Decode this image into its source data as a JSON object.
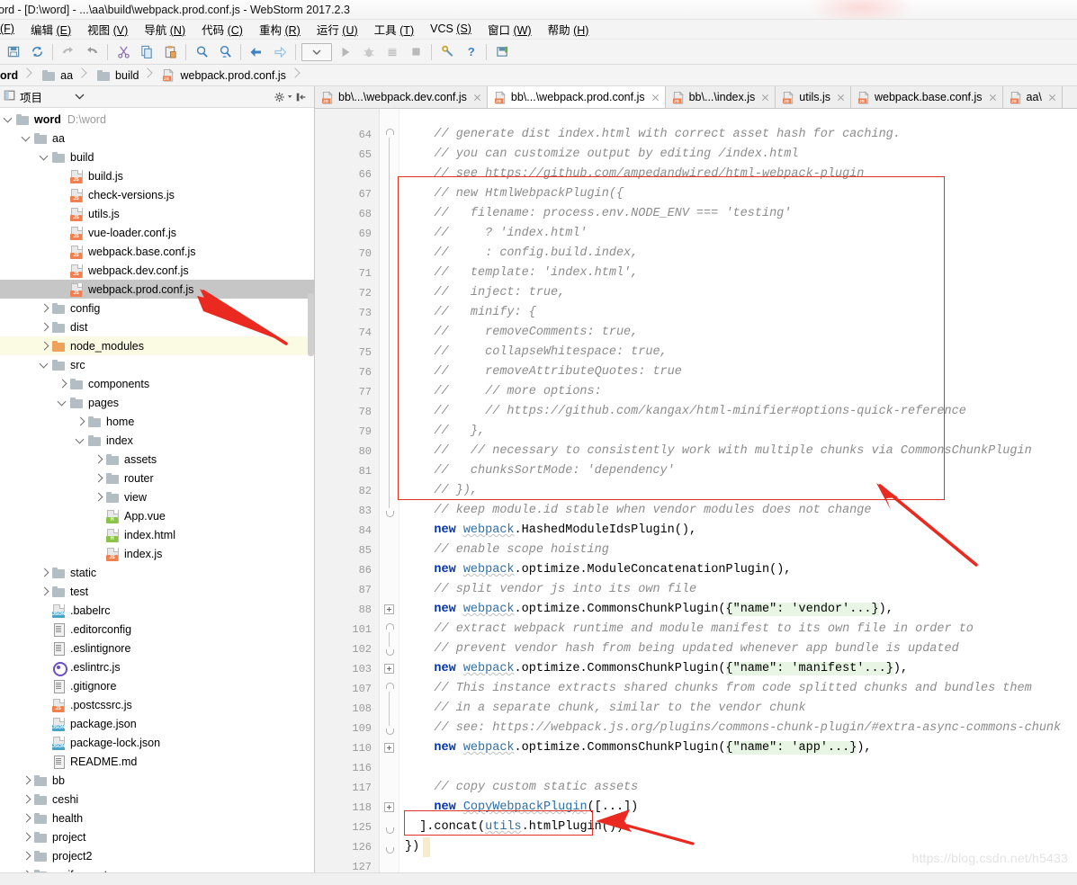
{
  "window": {
    "title": "ord - [D:\\word] - ...\\aa\\build\\webpack.prod.conf.js - WebStorm 2017.2.3"
  },
  "menubar": {
    "items": [
      {
        "label": "",
        "mnemonic": "(F)"
      },
      {
        "label": "编辑 ",
        "mnemonic": "(E)"
      },
      {
        "label": "视图 ",
        "mnemonic": "(V)"
      },
      {
        "label": "导航 ",
        "mnemonic": "(N)"
      },
      {
        "label": "代码 ",
        "mnemonic": "(C)"
      },
      {
        "label": "重构 ",
        "mnemonic": "(R)"
      },
      {
        "label": "运行 ",
        "mnemonic": "(U)"
      },
      {
        "label": "工具 ",
        "mnemonic": "(T)"
      },
      {
        "label": "VCS ",
        "mnemonic": "(S)"
      },
      {
        "label": "窗口 ",
        "mnemonic": "(W)"
      },
      {
        "label": "帮助 ",
        "mnemonic": "(H)"
      }
    ]
  },
  "toolbar": {
    "buttons": [
      "save-all-icon",
      "sync-icon",
      "sep",
      "undo-icon",
      "redo-icon",
      "sep",
      "cut-icon",
      "copy-icon",
      "paste-icon",
      "sep",
      "find-icon",
      "replace-icon",
      "sep",
      "back-icon",
      "forward-icon",
      "sep",
      "run-config-combo",
      "run-icon",
      "debug-icon",
      "coverage-icon",
      "stop-icon",
      "sep",
      "settings-wrench-icon",
      "help-icon",
      "sep",
      "save-screenshot-icon"
    ]
  },
  "breadcrumb": {
    "items": [
      {
        "label": "ord",
        "icon": "none",
        "bold": true
      },
      {
        "label": "aa",
        "icon": "folder"
      },
      {
        "label": "build",
        "icon": "folder"
      },
      {
        "label": "webpack.prod.conf.js",
        "icon": "js-file"
      }
    ]
  },
  "project_panel": {
    "header": {
      "title": "项目",
      "dropdown_icon": "chevron-down-icon",
      "settings_icon": "gear-icon",
      "hide_icon": "collapse-icon"
    },
    "tree": [
      {
        "depth": 0,
        "arrow": "down",
        "icon": "folder",
        "label": "word",
        "bold": true,
        "sub": "D:\\word"
      },
      {
        "depth": 1,
        "arrow": "down",
        "icon": "folder",
        "label": "aa"
      },
      {
        "depth": 2,
        "arrow": "down",
        "icon": "folder",
        "label": "build"
      },
      {
        "depth": 3,
        "arrow": "none",
        "icon": "js",
        "label": "build.js"
      },
      {
        "depth": 3,
        "arrow": "none",
        "icon": "js",
        "label": "check-versions.js"
      },
      {
        "depth": 3,
        "arrow": "none",
        "icon": "js",
        "label": "utils.js"
      },
      {
        "depth": 3,
        "arrow": "none",
        "icon": "js",
        "label": "vue-loader.conf.js"
      },
      {
        "depth": 3,
        "arrow": "none",
        "icon": "js",
        "label": "webpack.base.conf.js"
      },
      {
        "depth": 3,
        "arrow": "none",
        "icon": "js",
        "label": "webpack.dev.conf.js"
      },
      {
        "depth": 3,
        "arrow": "none",
        "icon": "js",
        "label": "webpack.prod.conf.js",
        "state": "selected"
      },
      {
        "depth": 2,
        "arrow": "right",
        "icon": "folder",
        "label": "config"
      },
      {
        "depth": 2,
        "arrow": "right",
        "icon": "folder",
        "label": "dist"
      },
      {
        "depth": 2,
        "arrow": "right",
        "icon": "folder-orange",
        "label": "node_modules",
        "state": "highlight"
      },
      {
        "depth": 2,
        "arrow": "down",
        "icon": "folder",
        "label": "src"
      },
      {
        "depth": 3,
        "arrow": "right",
        "icon": "folder",
        "label": "components"
      },
      {
        "depth": 3,
        "arrow": "down",
        "icon": "folder",
        "label": "pages"
      },
      {
        "depth": 4,
        "arrow": "right",
        "icon": "folder",
        "label": "home"
      },
      {
        "depth": 4,
        "arrow": "down",
        "icon": "folder",
        "label": "index"
      },
      {
        "depth": 5,
        "arrow": "right",
        "icon": "folder",
        "label": "assets"
      },
      {
        "depth": 5,
        "arrow": "right",
        "icon": "folder",
        "label": "router"
      },
      {
        "depth": 5,
        "arrow": "right",
        "icon": "folder",
        "label": "view"
      },
      {
        "depth": 5,
        "arrow": "none",
        "icon": "html",
        "label": "App.vue"
      },
      {
        "depth": 5,
        "arrow": "none",
        "icon": "html",
        "label": "index.html"
      },
      {
        "depth": 5,
        "arrow": "none",
        "icon": "js",
        "label": "index.js"
      },
      {
        "depth": 2,
        "arrow": "right",
        "icon": "folder",
        "label": "static"
      },
      {
        "depth": 2,
        "arrow": "right",
        "icon": "folder",
        "label": "test"
      },
      {
        "depth": 2,
        "arrow": "none",
        "icon": "json",
        "label": ".babelrc"
      },
      {
        "depth": 2,
        "arrow": "none",
        "icon": "txt",
        "label": ".editorconfig"
      },
      {
        "depth": 2,
        "arrow": "none",
        "icon": "txt",
        "label": ".eslintignore"
      },
      {
        "depth": 2,
        "arrow": "none",
        "icon": "circle",
        "label": ".eslintrc.js"
      },
      {
        "depth": 2,
        "arrow": "none",
        "icon": "txt",
        "label": ".gitignore"
      },
      {
        "depth": 2,
        "arrow": "none",
        "icon": "js",
        "label": ".postcssrc.js"
      },
      {
        "depth": 2,
        "arrow": "none",
        "icon": "json",
        "label": "package.json"
      },
      {
        "depth": 2,
        "arrow": "none",
        "icon": "json",
        "label": "package-lock.json"
      },
      {
        "depth": 2,
        "arrow": "none",
        "icon": "txt",
        "label": "README.md"
      },
      {
        "depth": 1,
        "arrow": "right",
        "icon": "folder",
        "label": "bb"
      },
      {
        "depth": 1,
        "arrow": "right",
        "icon": "folder",
        "label": "ceshi"
      },
      {
        "depth": 1,
        "arrow": "right",
        "icon": "folder",
        "label": "health"
      },
      {
        "depth": 1,
        "arrow": "right",
        "icon": "folder",
        "label": "project"
      },
      {
        "depth": 1,
        "arrow": "right",
        "icon": "folder",
        "label": "project2"
      },
      {
        "depth": 1,
        "arrow": "right",
        "icon": "folder",
        "label": "verify-master"
      }
    ]
  },
  "editor": {
    "tabs": [
      {
        "label": "bb\\...\\webpack.dev.conf.js",
        "icon": "js-file",
        "active": false
      },
      {
        "label": "bb\\...\\webpack.prod.conf.js",
        "icon": "js-file",
        "active": true
      },
      {
        "label": "bb\\...\\index.js",
        "icon": "js-file",
        "active": false
      },
      {
        "label": "utils.js",
        "icon": "js-file",
        "active": false
      },
      {
        "label": "webpack.base.conf.js",
        "icon": "js-file",
        "active": false
      },
      {
        "label": "aa\\",
        "icon": "js-file",
        "active": false
      }
    ],
    "lines": [
      {
        "num": "",
        "fold": "",
        "tokens": [
          {
            "t": "    //",
            "c": "cmt"
          }
        ],
        "clip": true
      },
      {
        "num": "64",
        "fold": "topcap",
        "tokens": [
          {
            "t": "    // generate dist index.html with correct asset hash for caching.",
            "c": "cmt"
          }
        ]
      },
      {
        "num": "65",
        "fold": "line",
        "tokens": [
          {
            "t": "    // you can customize output by editing /index.html",
            "c": "cmt"
          }
        ]
      },
      {
        "num": "66",
        "fold": "line",
        "tokens": [
          {
            "t": "    // see https://github.com/ampedandwired/html-webpack-plugin",
            "c": "cmt"
          }
        ]
      },
      {
        "num": "67",
        "fold": "line",
        "tokens": [
          {
            "t": "    // new HtmlWebpackPlugin({",
            "c": "cmt"
          }
        ]
      },
      {
        "num": "68",
        "fold": "line",
        "tokens": [
          {
            "t": "    //   filename: process.env.NODE_ENV === 'testing'",
            "c": "cmt"
          }
        ]
      },
      {
        "num": "69",
        "fold": "line",
        "tokens": [
          {
            "t": "    //     ? 'index.html'",
            "c": "cmt"
          }
        ]
      },
      {
        "num": "70",
        "fold": "line",
        "tokens": [
          {
            "t": "    //     : config.build.index,",
            "c": "cmt"
          }
        ]
      },
      {
        "num": "71",
        "fold": "line",
        "tokens": [
          {
            "t": "    //   template: 'index.html',",
            "c": "cmt"
          }
        ]
      },
      {
        "num": "72",
        "fold": "line",
        "tokens": [
          {
            "t": "    //   inject: true,",
            "c": "cmt"
          }
        ]
      },
      {
        "num": "73",
        "fold": "line",
        "tokens": [
          {
            "t": "    //   minify: {",
            "c": "cmt"
          }
        ]
      },
      {
        "num": "74",
        "fold": "line",
        "tokens": [
          {
            "t": "    //     removeComments: true,",
            "c": "cmt"
          }
        ]
      },
      {
        "num": "75",
        "fold": "line",
        "tokens": [
          {
            "t": "    //     collapseWhitespace: true,",
            "c": "cmt"
          }
        ]
      },
      {
        "num": "76",
        "fold": "line",
        "tokens": [
          {
            "t": "    //     removeAttributeQuotes: true",
            "c": "cmt"
          }
        ]
      },
      {
        "num": "77",
        "fold": "line",
        "tokens": [
          {
            "t": "    //     // more options:",
            "c": "cmt"
          }
        ]
      },
      {
        "num": "78",
        "fold": "line",
        "tokens": [
          {
            "t": "    //     // https://github.com/kangax/html-minifier#options-quick-reference",
            "c": "cmt"
          }
        ]
      },
      {
        "num": "79",
        "fold": "line",
        "tokens": [
          {
            "t": "    //   },",
            "c": "cmt"
          }
        ]
      },
      {
        "num": "80",
        "fold": "line",
        "tokens": [
          {
            "t": "    //   // necessary to consistently work with multiple chunks via CommonsChunkPlugin",
            "c": "cmt"
          }
        ]
      },
      {
        "num": "81",
        "fold": "line",
        "tokens": [
          {
            "t": "    //   chunksSortMode: 'dependency'",
            "c": "cmt"
          }
        ]
      },
      {
        "num": "82",
        "fold": "line",
        "tokens": [
          {
            "t": "    // }),",
            "c": "cmt"
          }
        ]
      },
      {
        "num": "83",
        "fold": "botcap",
        "tokens": [
          {
            "t": "    // keep module.id stable when vendor modules does not change",
            "c": "cmt"
          }
        ]
      },
      {
        "num": "84",
        "fold": "",
        "tokens": [
          {
            "t": "    ",
            "c": "pln"
          },
          {
            "t": "new",
            "c": "kw"
          },
          {
            "t": " ",
            "c": "pln"
          },
          {
            "t": "webpack",
            "c": "idn"
          },
          {
            "t": ".HashedModuleIdsPlugin(),",
            "c": "pln"
          }
        ]
      },
      {
        "num": "85",
        "fold": "",
        "tokens": [
          {
            "t": "    // enable scope hoisting",
            "c": "cmt"
          }
        ]
      },
      {
        "num": "86",
        "fold": "",
        "tokens": [
          {
            "t": "    ",
            "c": "pln"
          },
          {
            "t": "new",
            "c": "kw"
          },
          {
            "t": " ",
            "c": "pln"
          },
          {
            "t": "webpack",
            "c": "idn"
          },
          {
            "t": ".optimize.ModuleConcatenationPlugin(),",
            "c": "pln"
          }
        ]
      },
      {
        "num": "87",
        "fold": "",
        "tokens": [
          {
            "t": "    // split vendor js into its own file",
            "c": "cmt"
          }
        ]
      },
      {
        "num": "88",
        "fold": "plus",
        "tokens": [
          {
            "t": "    ",
            "c": "pln"
          },
          {
            "t": "new",
            "c": "kw"
          },
          {
            "t": " ",
            "c": "pln"
          },
          {
            "t": "webpack",
            "c": "idn"
          },
          {
            "t": ".optimize.CommonsChunkPlugin(",
            "c": "pln"
          },
          {
            "t": "{\"name\": 'vendor'...}",
            "c": "fold"
          },
          {
            "t": "),",
            "c": "pln"
          }
        ]
      },
      {
        "num": "101",
        "fold": "topcap",
        "tokens": [
          {
            "t": "    // extract webpack runtime and module manifest to its own file in order to",
            "c": "cmt"
          }
        ]
      },
      {
        "num": "102",
        "fold": "botcap",
        "tokens": [
          {
            "t": "    // prevent vendor hash from being updated whenever app bundle is updated",
            "c": "cmt"
          }
        ]
      },
      {
        "num": "103",
        "fold": "plus",
        "tokens": [
          {
            "t": "    ",
            "c": "pln"
          },
          {
            "t": "new",
            "c": "kw"
          },
          {
            "t": " ",
            "c": "pln"
          },
          {
            "t": "webpack",
            "c": "idn"
          },
          {
            "t": ".optimize.CommonsChunkPlugin(",
            "c": "pln"
          },
          {
            "t": "{\"name\": 'manifest'...}",
            "c": "fold"
          },
          {
            "t": "),",
            "c": "pln"
          }
        ]
      },
      {
        "num": "107",
        "fold": "topcap",
        "tokens": [
          {
            "t": "    // This instance extracts shared chunks from code splitted chunks and bundles them",
            "c": "cmt"
          }
        ]
      },
      {
        "num": "108",
        "fold": "",
        "tokens": [
          {
            "t": "    // in a separate chunk, similar to the vendor chunk",
            "c": "cmt"
          }
        ]
      },
      {
        "num": "109",
        "fold": "botcap",
        "tokens": [
          {
            "t": "    // see: https://webpack.js.org/plugins/commons-chunk-plugin/#extra-async-commons-chunk",
            "c": "cmt"
          }
        ]
      },
      {
        "num": "110",
        "fold": "plus",
        "tokens": [
          {
            "t": "    ",
            "c": "pln"
          },
          {
            "t": "new",
            "c": "kw"
          },
          {
            "t": " ",
            "c": "pln"
          },
          {
            "t": "webpack",
            "c": "idn"
          },
          {
            "t": ".optimize.CommonsChunkPlugin(",
            "c": "pln"
          },
          {
            "t": "{\"name\": 'app'...}",
            "c": "fold"
          },
          {
            "t": "),",
            "c": "pln"
          }
        ]
      },
      {
        "num": "116",
        "fold": "",
        "tokens": [
          {
            "t": "",
            "c": "pln"
          }
        ]
      },
      {
        "num": "117",
        "fold": "",
        "tokens": [
          {
            "t": "    // copy custom static assets",
            "c": "cmt"
          }
        ]
      },
      {
        "num": "118",
        "fold": "plus",
        "tokens": [
          {
            "t": "    ",
            "c": "pln"
          },
          {
            "t": "new",
            "c": "kw"
          },
          {
            "t": " ",
            "c": "pln"
          },
          {
            "t": "CopyWebpackPlugin",
            "c": "idn"
          },
          {
            "t": "([...])",
            "c": "pln"
          }
        ]
      },
      {
        "num": "125",
        "fold": "botcap",
        "tokens": [
          {
            "t": "  ].concat(",
            "c": "pln"
          },
          {
            "t": "utils",
            "c": "idn"
          },
          {
            "t": ".htmlPlugin())",
            "c": "pln"
          }
        ]
      },
      {
        "num": "126",
        "fold": "botcap",
        "tokens": [
          {
            "t": "})",
            "c": "pln"
          }
        ]
      },
      {
        "num": "127",
        "fold": "",
        "tokens": [
          {
            "t": "",
            "c": "pln"
          }
        ]
      }
    ],
    "annotations": {
      "box1_label": "commented-html-webpack-plugin-block",
      "box2_label": "concat-utils-htmlplugin-call",
      "arrow1_label": "arrow-to-selected-file",
      "arrow2_label": "arrow-to-commented-block",
      "arrow3_label": "arrow-to-concat-call"
    }
  },
  "watermark": {
    "text": "https://blog.csdn.net/h5433"
  }
}
